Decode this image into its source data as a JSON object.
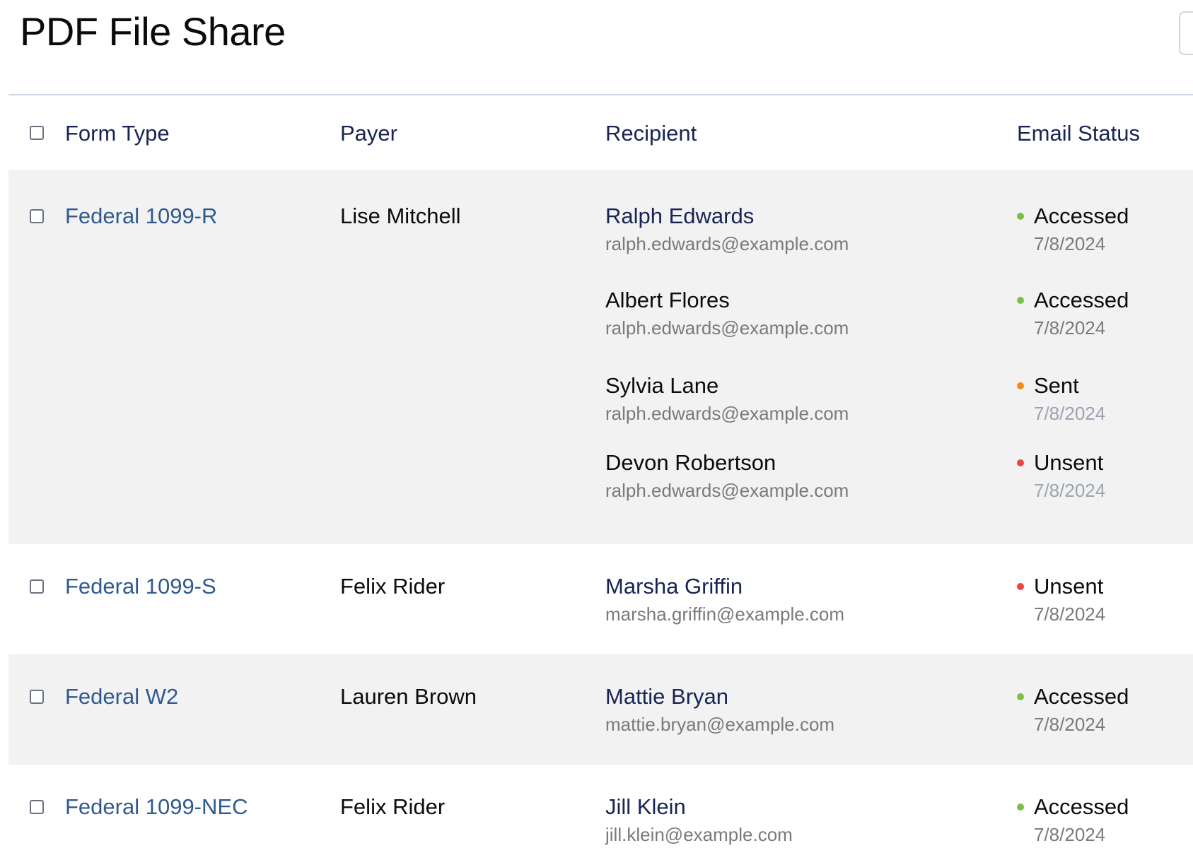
{
  "app": {
    "title": "PDF File Share"
  },
  "table": {
    "headers": {
      "form_type": "Form Type",
      "payer": "Payer",
      "recipient": "Recipient",
      "email_status": "Email Status"
    },
    "rows": [
      {
        "form_type": "Federal 1099-R",
        "payer": "Lise Mitchell",
        "recipients": [
          {
            "name": "Ralph Edwards",
            "email": "ralph.edwards@example.com",
            "status": "Accessed",
            "date": "7/8/2024"
          },
          {
            "name": "Albert Flores",
            "email": "ralph.edwards@example.com",
            "status": "Accessed",
            "date": "7/8/2024"
          },
          {
            "name": "Sylvia Lane",
            "email": "ralph.edwards@example.com",
            "status": "Sent",
            "date": "7/8/2024"
          },
          {
            "name": "Devon Robertson",
            "email": "ralph.edwards@example.com",
            "status": "Unsent",
            "date": "7/8/2024"
          }
        ]
      },
      {
        "form_type": "Federal 1099-S",
        "payer": "Felix Rider",
        "recipients": [
          {
            "name": "Marsha Griffin",
            "email": "marsha.griffin@example.com",
            "status": "Unsent",
            "date": "7/8/2024"
          }
        ]
      },
      {
        "form_type": "Federal W2",
        "payer": "Lauren Brown",
        "recipients": [
          {
            "name": "Mattie Bryan",
            "email": "mattie.bryan@example.com",
            "status": "Accessed",
            "date": "7/8/2024"
          }
        ]
      },
      {
        "form_type": "Federal 1099-NEC",
        "payer": "Felix Rider",
        "recipients": [
          {
            "name": "Jill Klein",
            "email": "jill.klein@example.com",
            "status": "Accessed",
            "date": "7/8/2024"
          }
        ]
      }
    ]
  },
  "colors": {
    "accessed": "#7cc043",
    "sent": "#f08a1c",
    "unsent": "#ef4444",
    "link": "#2f5a8f",
    "row_alt": "#f2f2f2"
  }
}
